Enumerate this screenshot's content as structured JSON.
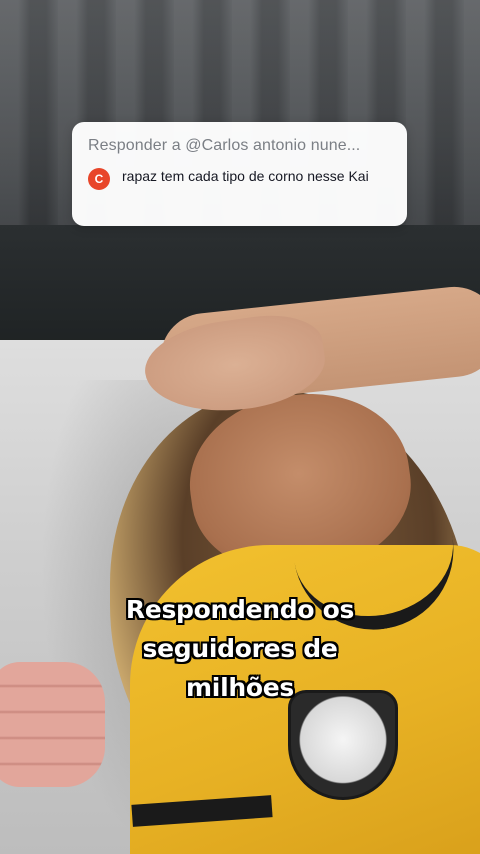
{
  "reply_card": {
    "title": "Responder a @Carlos antonio nune...",
    "avatar_letter": "C",
    "comment": "rapaz tem cada tipo de corno nesse Kai"
  },
  "caption": {
    "line1": "Respondendo os",
    "line2": "seguidores de",
    "line3": "milhões"
  },
  "colors": {
    "avatar": "#e8462a",
    "jersey": "#f2c12f"
  }
}
